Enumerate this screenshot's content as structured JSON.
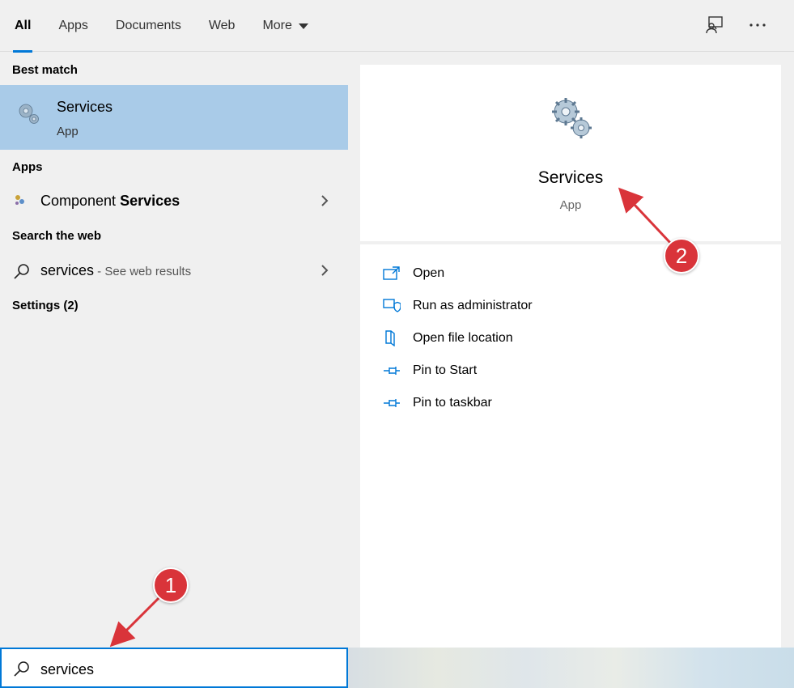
{
  "tabs": [
    {
      "label": "All",
      "active": true
    },
    {
      "label": "Apps",
      "active": false
    },
    {
      "label": "Documents",
      "active": false
    },
    {
      "label": "Web",
      "active": false
    },
    {
      "label": "More",
      "active": false
    }
  ],
  "left": {
    "best_match_title": "Best match",
    "best_match": {
      "name": "Services",
      "type": "App"
    },
    "apps_title": "Apps",
    "apps": [
      {
        "label_plain": "Component ",
        "label_bold": "Services"
      }
    ],
    "web_title": "Search the web",
    "web": {
      "query": "services",
      "hint": " - See web results"
    },
    "settings_title": "Settings (2)"
  },
  "preview": {
    "name": "Services",
    "type": "App",
    "actions": [
      "Open",
      "Run as administrator",
      "Open file location",
      "Pin to Start",
      "Pin to taskbar"
    ]
  },
  "search": {
    "value": "services"
  },
  "annotations": {
    "badge1": "1",
    "badge2": "2"
  },
  "colors": {
    "accent": "#0078d7",
    "selected": "#a9cbe8",
    "badge": "#d9343a"
  },
  "icons": [
    "feedback-icon",
    "more-options-icon",
    "gears-icon",
    "component-services-icon",
    "search-icon",
    "chevron-right-icon",
    "open-icon",
    "shield-icon",
    "folder-icon",
    "pin-icon"
  ]
}
